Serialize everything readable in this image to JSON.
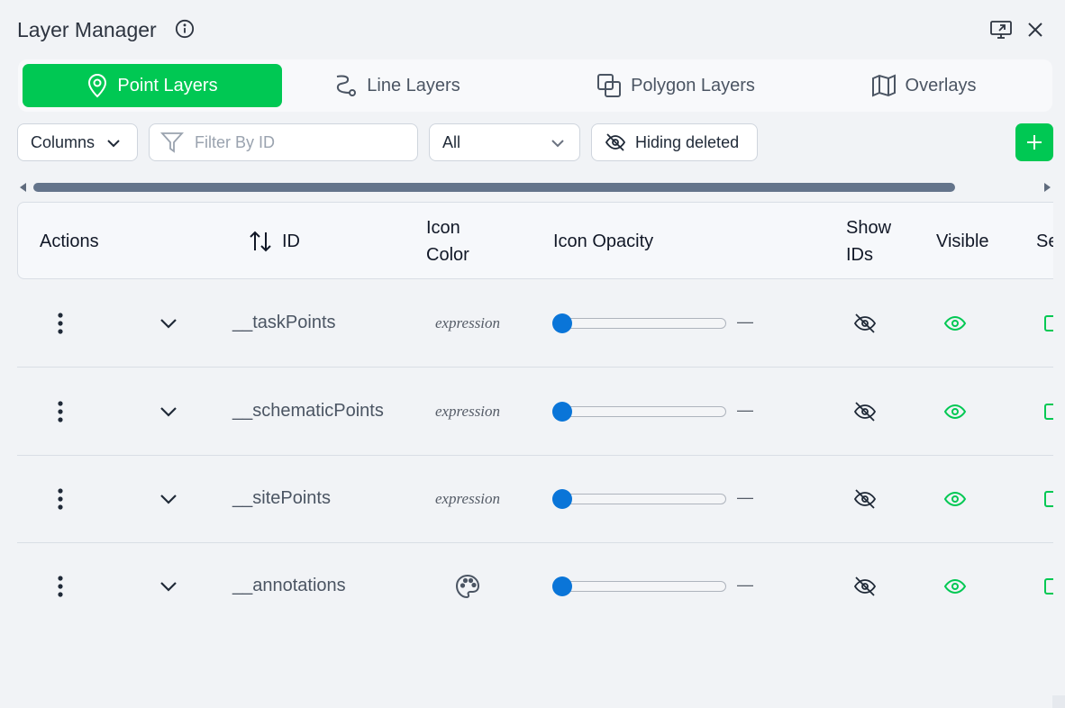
{
  "window": {
    "title": "Layer Manager"
  },
  "tabs": [
    {
      "label": "Point Layers",
      "active": true,
      "icon": "map-pin-icon"
    },
    {
      "label": "Line Layers",
      "active": false,
      "icon": "route-icon"
    },
    {
      "label": "Polygon Layers",
      "active": false,
      "icon": "polygon-icon"
    },
    {
      "label": "Overlays",
      "active": false,
      "icon": "map-icon"
    }
  ],
  "toolbar": {
    "columns_label": "Columns",
    "filter_placeholder": "Filter By ID",
    "filter_value": "",
    "select_value": "All",
    "hiding_label": "Hiding deleted"
  },
  "table": {
    "headers": {
      "actions": "Actions",
      "id": "ID",
      "icon_color_1": "Icon",
      "icon_color_2": "Color",
      "icon_opacity": "Icon Opacity",
      "show_ids_1": "Show",
      "show_ids_2": "IDs",
      "visible": "Visible",
      "next": "Se"
    },
    "rows": [
      {
        "id": "__taskPoints",
        "icon_color": "expression",
        "opacity": 0,
        "opacity_text": "—"
      },
      {
        "id": "__schematicPoints",
        "icon_color": "expression",
        "opacity": 0,
        "opacity_text": "—"
      },
      {
        "id": "__sitePoints",
        "icon_color": "expression",
        "opacity": 0,
        "opacity_text": "—"
      },
      {
        "id": "__annotations",
        "icon_color": "",
        "icon_color_icon": "palette-icon",
        "opacity": 0,
        "opacity_text": "—"
      }
    ]
  },
  "colors": {
    "accent": "#00c853",
    "slider": "#0a75d8",
    "scroll_thumb": "#64748b"
  }
}
